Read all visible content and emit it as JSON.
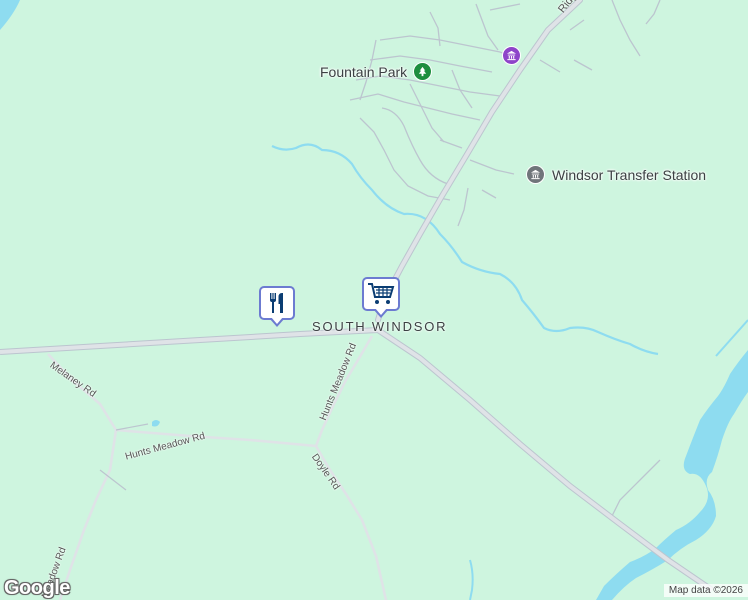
{
  "labels": {
    "fountain_park": "Fountain Park",
    "transfer_station": "Windsor Transfer Station",
    "south_windsor": "SOUTH WINDSOR",
    "ridge_rd": "Ridge",
    "hunts_meadow_rd_vertical": "Hunts Meadow Rd",
    "hunts_meadow_rd_horizontal": "Hunts Meadow Rd",
    "melaney_rd": "Melaney Rd",
    "doyle_rd": "Doyle Rd",
    "meadow_rd_bottom": "Meadow Rd"
  },
  "markers": [
    {
      "name": "restaurant-marker",
      "icon": "fork-knife-icon"
    },
    {
      "name": "shopping-marker",
      "icon": "shopping-cart-icon"
    }
  ],
  "colors": {
    "land": "#cef5df",
    "water": "#8edcf0",
    "road_major": "#d8dde0",
    "road_minor": "#bcc5cf",
    "park_icon": "#1e8e3e",
    "museum_icon": "#8e44c9",
    "gov_icon": "#70757a",
    "marker_border": "#6c7bd1",
    "marker_icon": "#0b3d73"
  },
  "footer": {
    "logo": "Google",
    "attribution": "Map data ©2026"
  }
}
